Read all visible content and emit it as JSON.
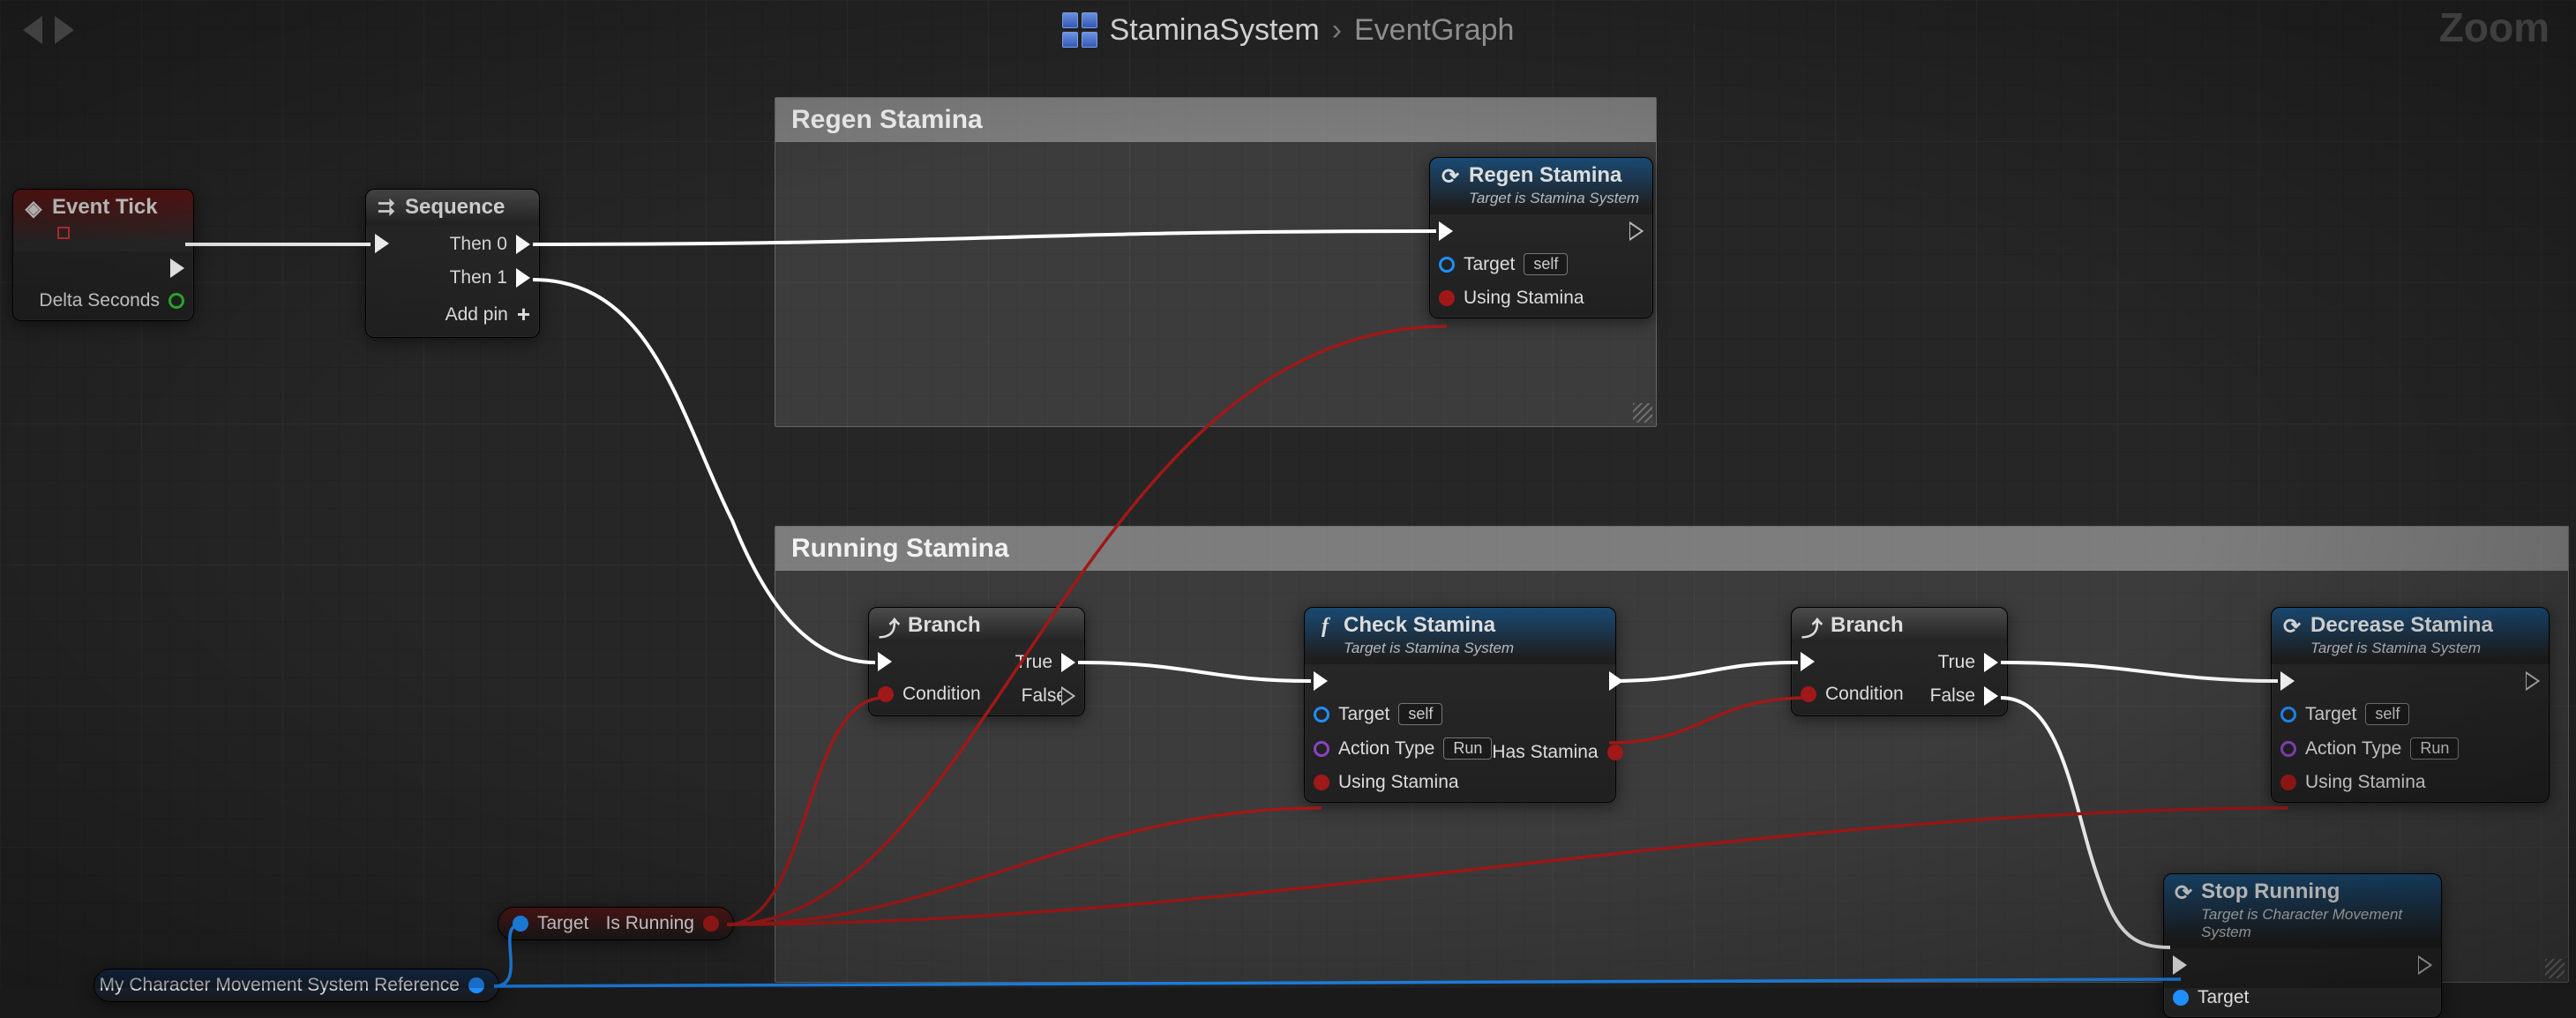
{
  "breadcrumb": {
    "asset": "StaminaSystem",
    "graph": "EventGraph"
  },
  "zoom_label": "Zoom",
  "comments": {
    "regen": {
      "title": "Regen Stamina"
    },
    "running": {
      "title": "Running Stamina"
    }
  },
  "nodes": {
    "event_tick": {
      "title": "Event Tick",
      "out_pins": [
        "Delta Seconds"
      ]
    },
    "sequence": {
      "title": "Sequence",
      "outs": [
        "Then 0",
        "Then 1"
      ],
      "add_pin": "Add pin"
    },
    "regen": {
      "title": "Regen Stamina",
      "subtitle": "Target is Stamina System",
      "target": "Target",
      "self": "self",
      "using": "Using Stamina"
    },
    "branch1": {
      "title": "Branch",
      "condition": "Condition",
      "true": "True",
      "false": "False"
    },
    "check": {
      "title": "Check Stamina",
      "subtitle": "Target is Stamina System",
      "target": "Target",
      "self": "self",
      "action_type": "Action Type",
      "action_val": "Run",
      "using": "Using Stamina",
      "has": "Has Stamina"
    },
    "branch2": {
      "title": "Branch",
      "condition": "Condition",
      "true": "True",
      "false": "False"
    },
    "decrease": {
      "title": "Decrease Stamina",
      "subtitle": "Target is Stamina System",
      "target": "Target",
      "self": "self",
      "action_type": "Action Type",
      "action_val": "Run",
      "using": "Using Stamina"
    },
    "stop": {
      "title": "Stop Running",
      "subtitle": "Target is Character Movement System",
      "target": "Target"
    },
    "is_running": {
      "target": "Target",
      "label": "Is Running"
    },
    "move_ref": {
      "label": "My Character Movement System Reference"
    }
  }
}
